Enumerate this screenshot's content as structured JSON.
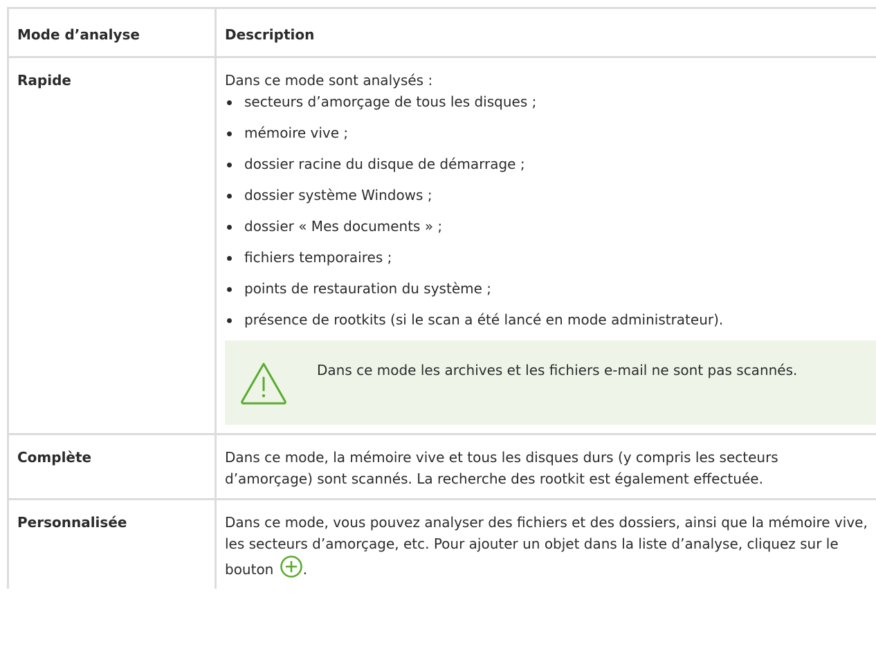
{
  "table": {
    "headers": {
      "mode": "Mode d’analyse",
      "description": "Description"
    },
    "rows": [
      {
        "mode": "Rapide",
        "intro": "Dans ce mode sont analysés :",
        "items": [
          "secteurs d’amorçage de tous les disques ;",
          "mémoire vive ;",
          "dossier racine du disque de démarrage ;",
          "dossier système Windows ;",
          "dossier « Mes documents » ;",
          "fichiers temporaires ;",
          "points de restauration du système ;",
          "présence de rootkits (si le scan a été lancé en mode administrateur)."
        ],
        "note": {
          "icon": "warning-triangle-icon",
          "text": "Dans ce mode les archives et les fichiers e-mail ne sont pas scannés."
        }
      },
      {
        "mode": "Complète",
        "text": "Dans ce mode, la mémoire vive et tous les disques durs (y compris les secteurs d’amorçage) sont scannés. La recherche des rootkit est également effectuée."
      },
      {
        "mode": "Personnalisée",
        "text": "Dans ce mode, vous pouvez analyser des fichiers et des dossiers, ainsi que la mémoire vive, les secteurs d’amorçage, etc. Pour ajouter un objet dans la liste d’analyse, cliquez sur le bouton",
        "text_after_icon": ".",
        "icon": "add-circle-icon"
      }
    ]
  },
  "colors": {
    "border": "#dcdcdc",
    "note_background": "#eef5e8",
    "accent_green": "#5aab2e",
    "text": "#2b2b2b"
  }
}
